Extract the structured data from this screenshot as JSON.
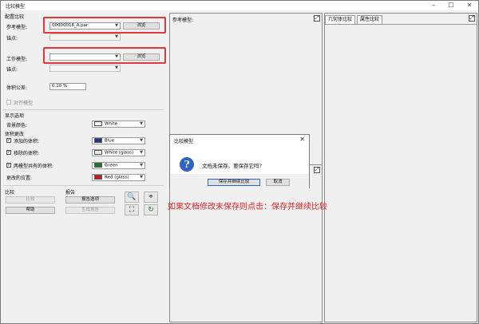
{
  "window": {
    "title": "比较模型",
    "min_icon": "minimize-icon",
    "max_icon": "maximize-icon",
    "close_icon": "close-icon"
  },
  "config": {
    "section_title": "配置比较",
    "ref_model_label": "参考模型:",
    "ref_model_value": "00000016_A.par",
    "browse_label": "浏览",
    "ref_anchor_label": "锚点:",
    "work_model_label": "工作模型:",
    "work_model_value": "",
    "work_anchor_label": "锚点:",
    "volume_tol_label": "体积公差:",
    "volume_tol_value": "0.10 %",
    "align_label": "对齐模型"
  },
  "display": {
    "section_title": "显示选项",
    "bg_color_label": "背景颜色:",
    "bg_color_value": "White",
    "volume_change_title": "体积更改",
    "added_volume_label": "添加的体积:",
    "added_volume_value": "Blue",
    "removed_volume_label": "移除的体积:",
    "removed_volume_value": "White (glass)",
    "shared_volume_label": "两模型共有的体积:",
    "shared_volume_value": "Green",
    "changed_position_label": "更改的位置:",
    "changed_position_value": "Red (glass)",
    "colors": {
      "white": "#ffffff",
      "blue": "#1a3a8c",
      "glass": "#e8e8e8",
      "green": "#1d7a2a",
      "red": "#c81e1e"
    }
  },
  "compare": {
    "section_title": "比较",
    "compare_btn": "比较",
    "help_btn": "帮助"
  },
  "report": {
    "section_title": "报告",
    "options_btn": "报告选项",
    "generate_btn": "生成报告"
  },
  "tools": [
    "zoom-icon",
    "fit-view-icon",
    "select-icon",
    "refresh-icon"
  ],
  "viewport": {
    "ref_title": "参考模型:",
    "tabs": [
      "几何体比较",
      "属性比较"
    ]
  },
  "dialog": {
    "title": "比较模型",
    "message": "文档未保存。要保存它吗?",
    "save_btn": "保存并继续比较",
    "cancel_btn": "取消",
    "icon": "question-icon"
  },
  "annotation": "如果文档修改未保存则点击：保存并继续比较"
}
